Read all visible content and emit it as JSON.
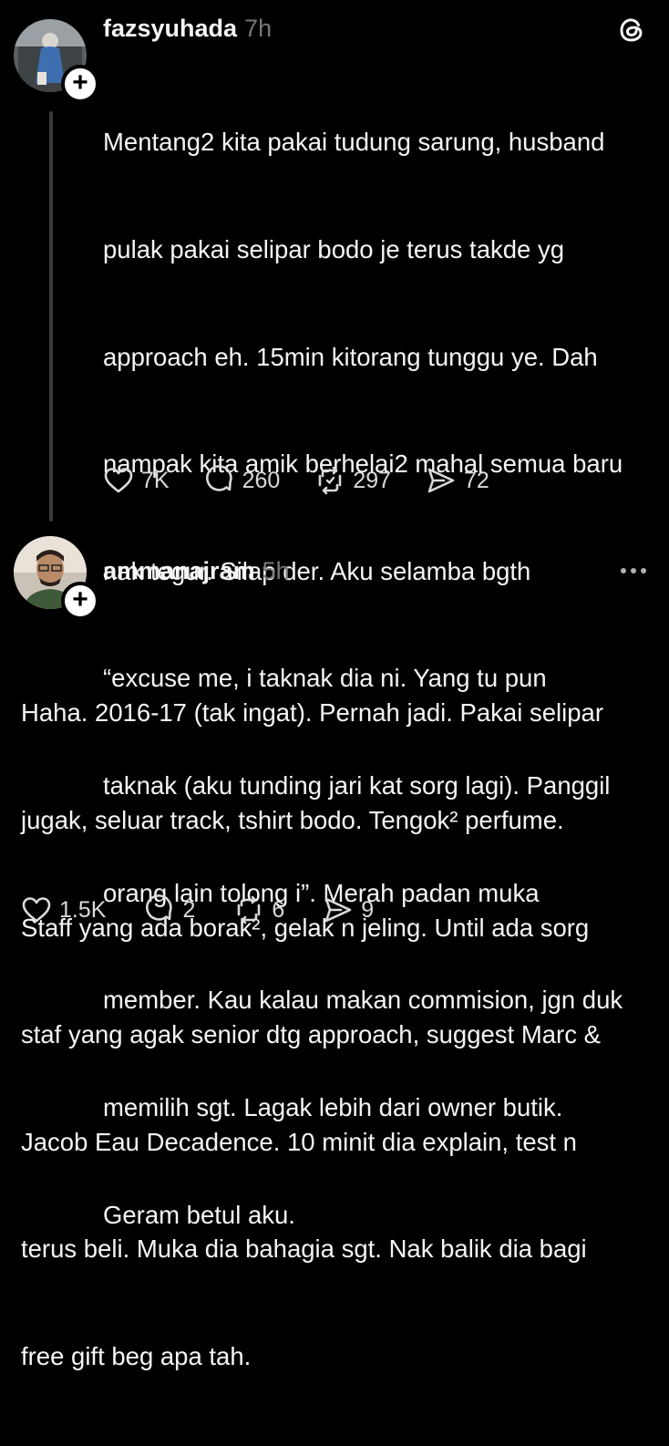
{
  "post1": {
    "username": "fazsyuhada",
    "time": "7h",
    "lines": [
      "Mentang2 kita pakai tudung sarung, husband",
      "pulak pakai selipar bodo je terus takde yg",
      "approach eh. 15min kitorang tunggu ye. Dah",
      "nampak kita amik berhelai2 mahal semua baru",
      "nak tegur. Silap der. Aku selamba bgth",
      "“excuse me, i taknak dia ni. Yang tu pun",
      "taknak (aku tunding jari kat sorg lagi). Panggil",
      "orang lain tolong i”. Merah padan muka",
      "member. Kau kalau makan commision, jgn duk",
      "memilih sgt. Lagak lebih dari owner butik.",
      "Geram betul aku."
    ],
    "likes": "7K",
    "replies": "260",
    "reposts": "297",
    "shares": "72"
  },
  "post2": {
    "username": "ammanajram",
    "time": "5h",
    "lines": [
      "Haha. 2016-17 (tak ingat). Pernah jadi. Pakai selipar",
      "jugak, seluar track, tshirt bodo. Tengok² perfume.",
      "Staff yang ada borak², gelak n jeling. Until ada sorg",
      "staf yang agak senior dtg approach, suggest Marc &",
      "Jacob Eau Decadence. 10 minit dia explain, test n",
      "terus beli. Muka dia bahagia sgt. Nak balik dia bagi",
      "free gift beg apa tah."
    ],
    "likes": "1.5K",
    "replies": "2",
    "reposts": "6",
    "shares": "9"
  },
  "icons": {
    "threads_logo": "threads-logo-icon",
    "like": "heart-icon",
    "reply": "comment-icon",
    "repost": "repost-icon",
    "share": "send-icon",
    "more": "more-icon",
    "follow": "plus-icon"
  },
  "colors": {
    "background": "#000000",
    "text": "#f3f5f7",
    "muted": "#77777b",
    "thread_line": "#3a3a3c"
  }
}
